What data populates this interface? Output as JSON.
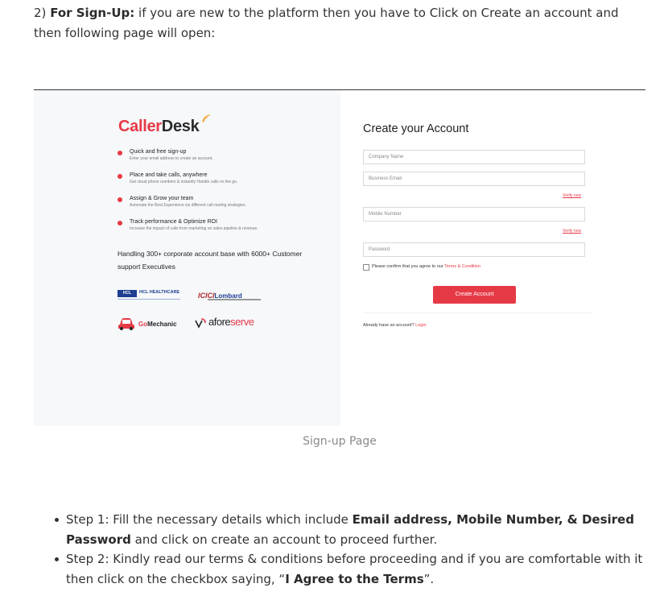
{
  "intro": {
    "number": "2)",
    "bold": "For Sign-Up:",
    "text": " if you are new to the platform then you have to Click on Create an account and then following page will open:"
  },
  "left_panel": {
    "logo_caller": "Caller",
    "logo_desk": "Desk",
    "features": [
      {
        "title": "Quick and free sign-up",
        "subtitle": "Enter your email address to create an account."
      },
      {
        "title": "Place and take calls, anywhere",
        "subtitle": "Get cloud phone numbers & instantly Handle calls on the go."
      },
      {
        "title": "Assign & Grow your team",
        "subtitle": "Automate the Best Experience via different call routing strategies."
      },
      {
        "title": "Track performance & Optimize ROI",
        "subtitle": "Increase the impact of calls from marketing on sales pipeline & revenue."
      }
    ],
    "handling_text": "Handling 300+ corporate account base with 6000+ Customer support Executives",
    "brands": {
      "hcl_box": "HCL",
      "hcl_name": "HCL HEALTHCARE",
      "icici_a": "ICICI",
      "icici_b": "Lombard",
      "gomech_go": "Go",
      "gomech_rest": "Mechanic",
      "afore_a": "afore",
      "afore_b": "serve"
    }
  },
  "form": {
    "title": "Create your Account",
    "company_placeholder": "Company Name",
    "email_placeholder": "Business Email",
    "verify_label": "Verify now",
    "mobile_placeholder": "Mobile Number",
    "verify_label_2": "Verify now",
    "password_placeholder": "Password",
    "consent_text": "Please confirm that you agree to our ",
    "consent_link": "Terms & Condition",
    "create_button": "Create Account",
    "already_text": "Already have an account? ",
    "login_link": "Login"
  },
  "caption": "Sign-up Page",
  "steps": [
    {
      "pre": "Step 1: Fill the necessary details which include ",
      "bold": "Email address, Mobile Number, & Desired Password",
      "post": " and click on create an account to proceed further."
    },
    {
      "pre": "Step 2: Kindly read our terms & conditions before proceeding and if you are comfortable with it then click on the checkbox saying, “",
      "bold": "I Agree to the Terms",
      "post": "”."
    }
  ],
  "colors": {
    "accent": "#e63946",
    "text": "#333333",
    "caption": "#8a8a8a",
    "panel_bg": "#f6f8fa"
  }
}
